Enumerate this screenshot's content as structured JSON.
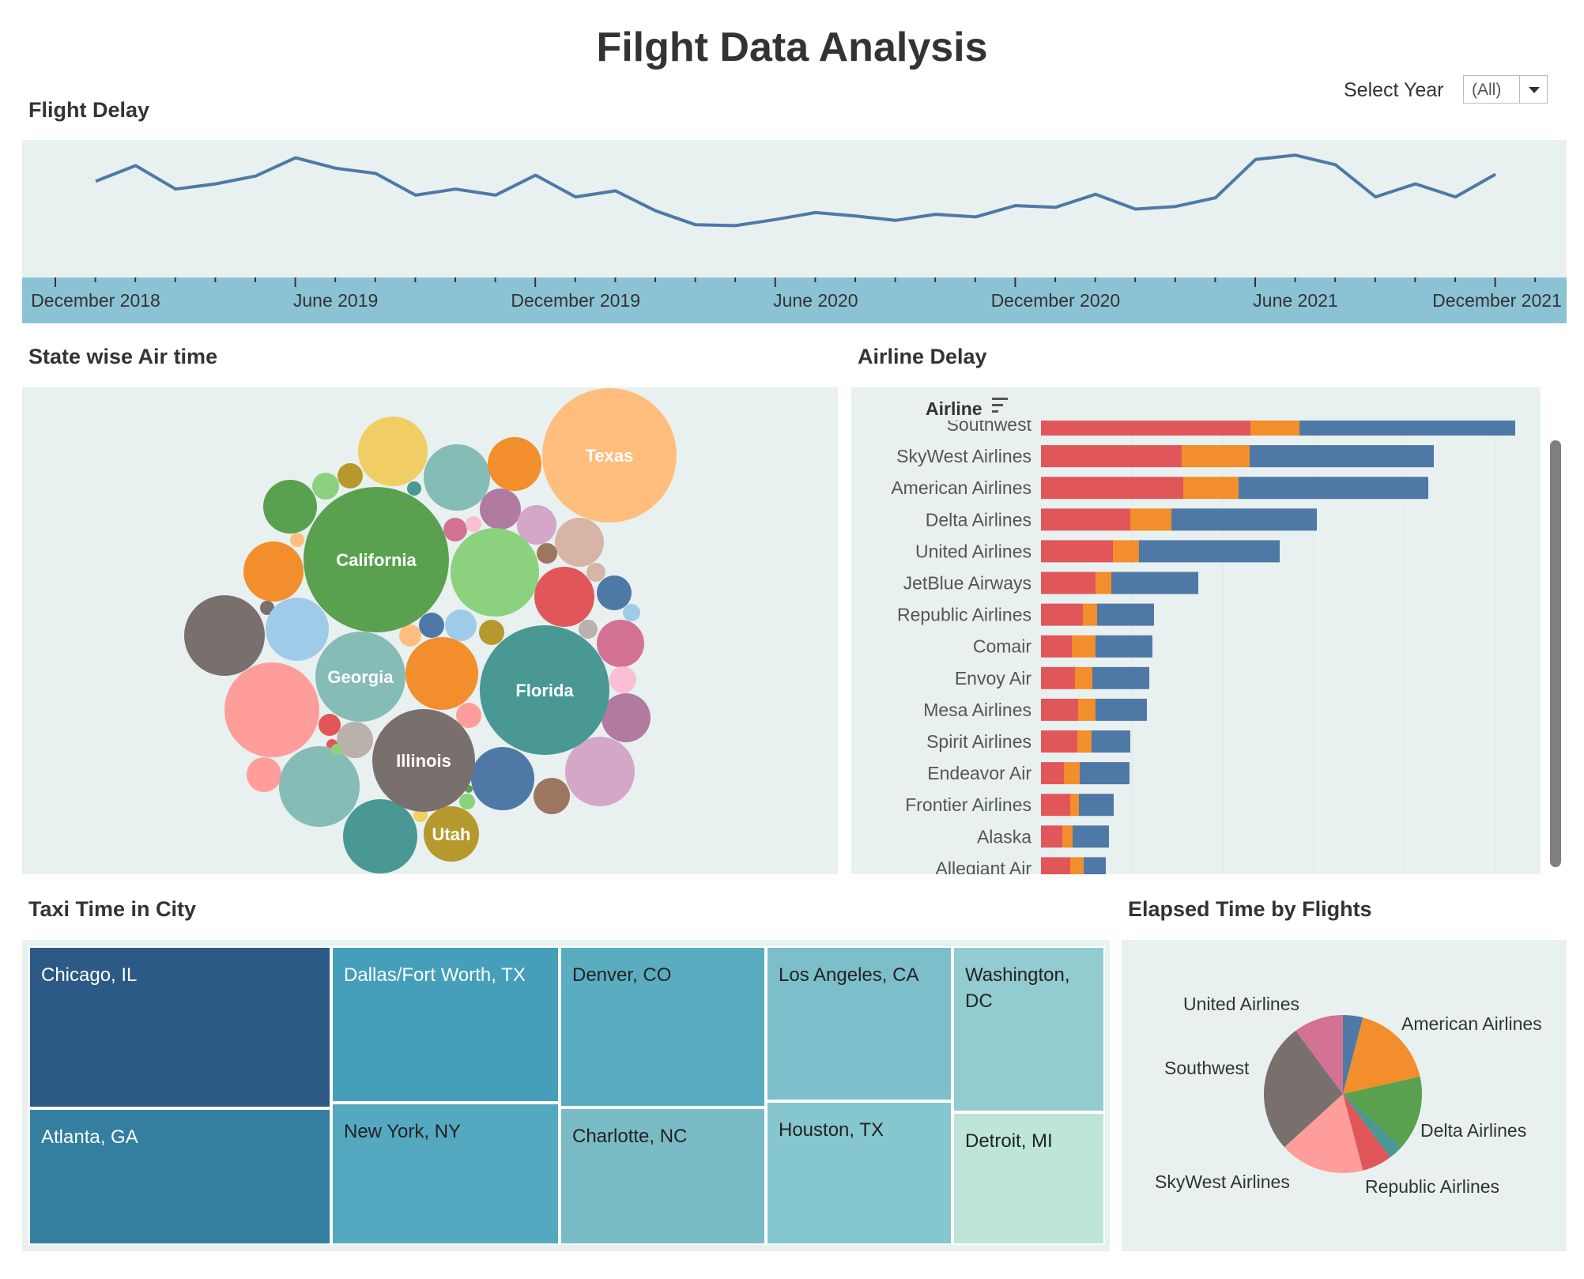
{
  "dashboard": {
    "title": "Filght Data Analysis"
  },
  "filter": {
    "label": "Select Year",
    "value": "(All)"
  },
  "sections": {
    "flight_delay": "Flight Delay",
    "state_air_time": "State wise Air time",
    "airline_delay": "Airline Delay",
    "taxi_time": "Taxi Time in City",
    "elapsed_time": "Elapsed Time by Flights"
  },
  "chart_data": [
    {
      "id": "flight_delay",
      "type": "line",
      "title": "Flight Delay",
      "x": [
        "2018-11",
        "2018-12",
        "2019-01",
        "2019-02",
        "2019-03",
        "2019-04",
        "2019-05",
        "2019-06",
        "2019-07",
        "2019-08",
        "2019-09",
        "2019-10",
        "2019-11",
        "2019-12",
        "2020-01",
        "2020-02",
        "2020-03",
        "2020-04",
        "2020-05",
        "2020-06",
        "2020-07",
        "2020-08",
        "2020-09",
        "2020-10",
        "2020-11",
        "2020-12",
        "2021-01",
        "2021-02",
        "2021-03",
        "2021-04",
        "2021-05",
        "2021-06",
        "2021-07",
        "2021-08",
        "2021-09",
        "2021-10",
        "2021-11",
        "2021-12"
      ],
      "x_tick_labels": [
        "December 2018",
        "June 2019",
        "December 2019",
        "June 2020",
        "December 2020",
        "June 2021",
        "December 2021"
      ],
      "values": [
        0.67,
        0.85,
        0.58,
        0.64,
        0.73,
        0.94,
        0.82,
        0.76,
        0.51,
        0.58,
        0.51,
        0.74,
        0.49,
        0.56,
        0.33,
        0.17,
        0.16,
        0.23,
        0.31,
        0.27,
        0.22,
        0.29,
        0.26,
        0.39,
        0.37,
        0.52,
        0.35,
        0.38,
        0.48,
        0.92,
        0.97,
        0.86,
        0.49,
        0.64,
        0.49,
        0.75
      ],
      "series_color": "#4e79a7"
    },
    {
      "id": "state_air_time",
      "type": "bubble",
      "title": "State wise Air time",
      "labeled": [
        {
          "name": "Texas",
          "color": "#ffbe7d"
        },
        {
          "name": "California",
          "color": "#59a14f"
        },
        {
          "name": "Florida",
          "color": "#499894"
        },
        {
          "name": "Georgia",
          "color": "#86bcb6"
        },
        {
          "name": "Illinois",
          "color": "#79706e"
        },
        {
          "name": "Utah",
          "color": "#b6992d"
        }
      ]
    },
    {
      "id": "airline_delay",
      "type": "bar",
      "stacked": true,
      "orientation": "horizontal",
      "axis_title": "Airline",
      "categories": [
        "Southwest",
        "SkyWest Airlines",
        "American Airlines",
        "Delta Airlines",
        "United Airlines",
        "JetBlue Airways",
        "Republic Airlines",
        "Comair",
        "Envoy Air",
        "Mesa Airlines",
        "Spirit Airlines",
        "Endeavor Air",
        "Frontier Airlines",
        "Alaska",
        "Allegiant Air"
      ],
      "series": [
        {
          "color": "#e15759",
          "values": [
            265,
            178,
            180,
            113,
            91,
            69,
            53,
            39,
            43,
            47,
            46,
            29,
            37,
            27,
            37
          ]
        },
        {
          "color": "#f28e2b",
          "values": [
            62,
            86,
            70,
            52,
            33,
            20,
            18,
            30,
            22,
            22,
            18,
            20,
            11,
            13,
            17
          ]
        },
        {
          "color": "#4e79a7",
          "values": [
            273,
            233,
            240,
            184,
            178,
            110,
            72,
            72,
            72,
            65,
            49,
            63,
            44,
            46,
            28
          ]
        }
      ]
    },
    {
      "id": "taxi_time",
      "type": "treemap",
      "cells": [
        {
          "name": "Chicago, IL",
          "color": "#2c5985"
        },
        {
          "name": "Atlanta, GA",
          "color": "#347ea0"
        },
        {
          "name": "Dallas/Fort Worth, TX",
          "color": "#459fba"
        },
        {
          "name": "New York, NY",
          "color": "#54a8c0"
        },
        {
          "name": "Denver, CO",
          "color": "#5aadc1"
        },
        {
          "name": "Charlotte, NC",
          "color": "#79bcc6"
        },
        {
          "name": "Los Angeles, CA",
          "color": "#7cbfca"
        },
        {
          "name": "Houston, TX",
          "color": "#86c6cf"
        },
        {
          "name": "Washington, DC",
          "color": "#92cbd0"
        },
        {
          "name": "Detroit, MI",
          "color": "#bde5d9"
        }
      ]
    },
    {
      "id": "elapsed_time",
      "type": "pie",
      "slices": [
        {
          "name": "",
          "value": 4,
          "color": "#4e79a7"
        },
        {
          "name": "American Airlines",
          "value": 17,
          "color": "#f28e2b"
        },
        {
          "name": "Delta Airlines",
          "value": 15,
          "color": "#59a14f"
        },
        {
          "name": "",
          "value": 3,
          "color": "#499894"
        },
        {
          "name": "Republic Airlines",
          "value": 6,
          "color": "#e15759"
        },
        {
          "name": "SkyWest Airlines",
          "value": 17,
          "color": "#ff9d9a"
        },
        {
          "name": "Southwest",
          "value": 26,
          "color": "#79706e"
        },
        {
          "name": "United Airlines",
          "value": 10,
          "color": "#d37295"
        }
      ]
    }
  ]
}
